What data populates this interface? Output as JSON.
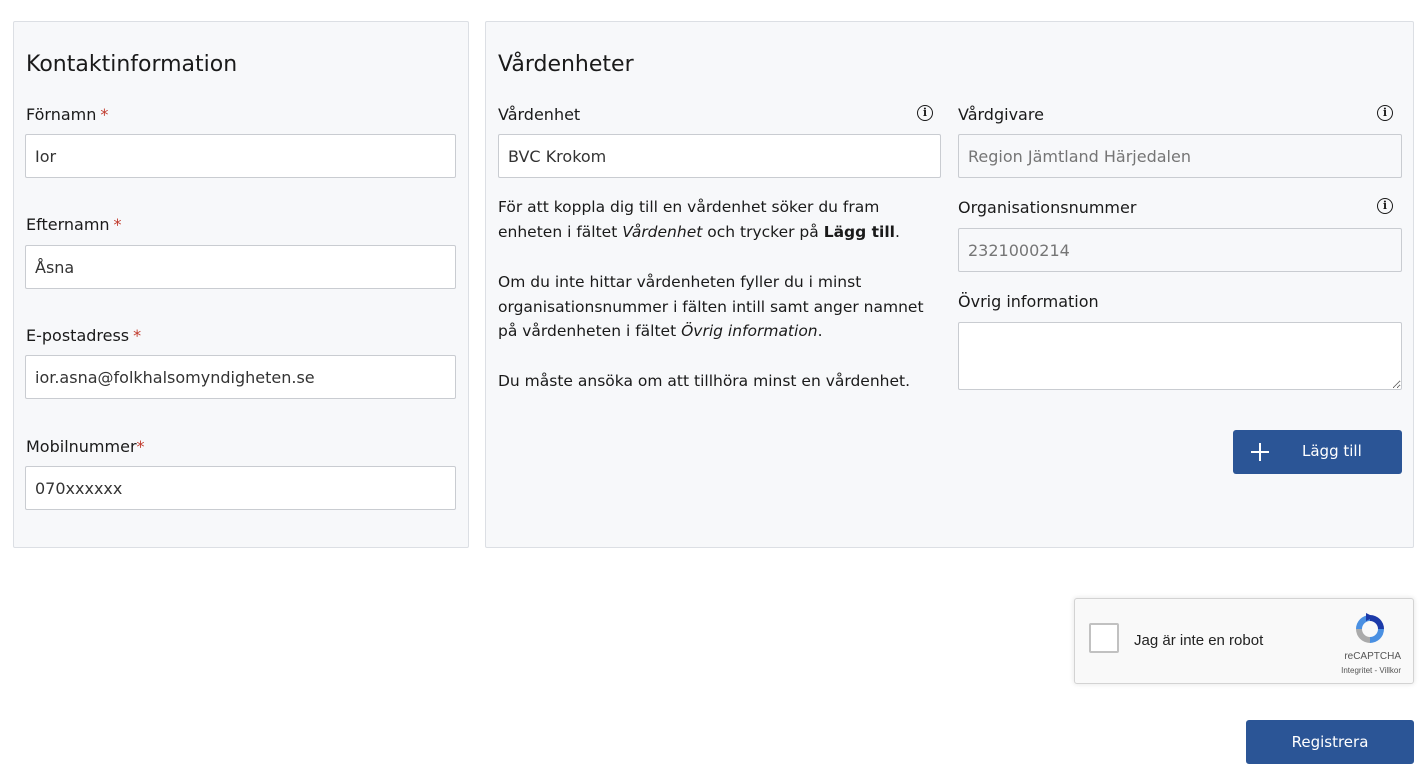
{
  "contact": {
    "title": "Kontaktinformation",
    "first_name": {
      "label": "Förnamn",
      "required_mark": "*",
      "value": "Ior"
    },
    "last_name": {
      "label": "Efternamn",
      "required_mark": "*",
      "value": "Åsna"
    },
    "email": {
      "label": "E-postadress",
      "required_mark": "*",
      "value": "ior.asna@folkhalsomyndigheten.se"
    },
    "mobile": {
      "label": "Mobilnummer",
      "required_mark": "*",
      "value": "070xxxxxx"
    }
  },
  "units": {
    "title": "Vårdenheter",
    "unit": {
      "label": "Vårdenhet",
      "value": "BVC Krokom"
    },
    "provider": {
      "label": "Vårdgivare",
      "placeholder": "Region Jämtland Härjedalen"
    },
    "org_number": {
      "label": "Organisationsnummer",
      "placeholder": "2321000214"
    },
    "other_info": {
      "label": "Övrig information",
      "value": ""
    },
    "help": {
      "p1_a": "För att koppla dig till en vårdenhet söker du fram enheten i fältet ",
      "p1_em": "Vårdenhet",
      "p1_b": " och trycker på ",
      "p1_strong": "Lägg till",
      "p1_c": ".",
      "p2_a": "Om du inte hittar vårdenheten fyller du i minst organisationsnummer i fälten intill samt anger namnet på vårdenheten i fältet ",
      "p2_em": "Övrig information",
      "p2_b": ".",
      "p3": "Du måste ansöka om att tillhöra minst en vårdenhet."
    },
    "add_button_label": "Lägg till"
  },
  "recaptcha": {
    "label": "Jag är inte en robot",
    "brand": "reCAPTCHA",
    "privacy": "Integritet",
    "separator": " - ",
    "terms": "Villkor"
  },
  "register_button_label": "Registrera",
  "colors": {
    "primary_button": "#2b5596",
    "required_mark": "#c0392b",
    "panel_background": "#f7f8fa"
  },
  "icons": [
    "info-icon",
    "plus-icon",
    "recaptcha-logo-icon"
  ]
}
